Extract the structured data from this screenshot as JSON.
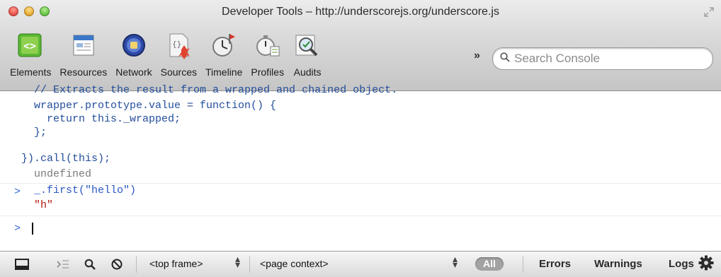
{
  "window": {
    "title": "Developer Tools – http://underscorejs.org/underscore.js"
  },
  "toolbar": {
    "tools": [
      {
        "label": "Elements",
        "icon": "elements-icon"
      },
      {
        "label": "Resources",
        "icon": "resources-icon"
      },
      {
        "label": "Network",
        "icon": "network-icon"
      },
      {
        "label": "Sources",
        "icon": "sources-icon"
      },
      {
        "label": "Timeline",
        "icon": "timeline-icon"
      },
      {
        "label": "Profiles",
        "icon": "profiles-icon"
      },
      {
        "label": "Audits",
        "icon": "audits-icon"
      }
    ],
    "more_label": "»",
    "search": {
      "placeholder": "Search Console",
      "value": ""
    }
  },
  "console": {
    "lines": [
      "  // Extracts the result from a wrapped and chained object.",
      "  wrapper.prototype.value = function() {",
      "    return this._wrapped;",
      "  };",
      "}).call(this);"
    ],
    "result_1": "undefined",
    "input_2": "_.first(\"hello\")",
    "result_2": "\"h\"",
    "prompt_symbol": ">"
  },
  "statusbar": {
    "frame_select": "<top frame>",
    "context_select": "<page context>",
    "filters": {
      "all": "All",
      "errors": "Errors",
      "warnings": "Warnings",
      "logs": "Logs"
    }
  },
  "colors": {
    "code_blue": "#234e9a",
    "string_red": "#b11a14",
    "muted_gray": "#7a7a7a",
    "prompt_blue": "#2f69d6"
  }
}
